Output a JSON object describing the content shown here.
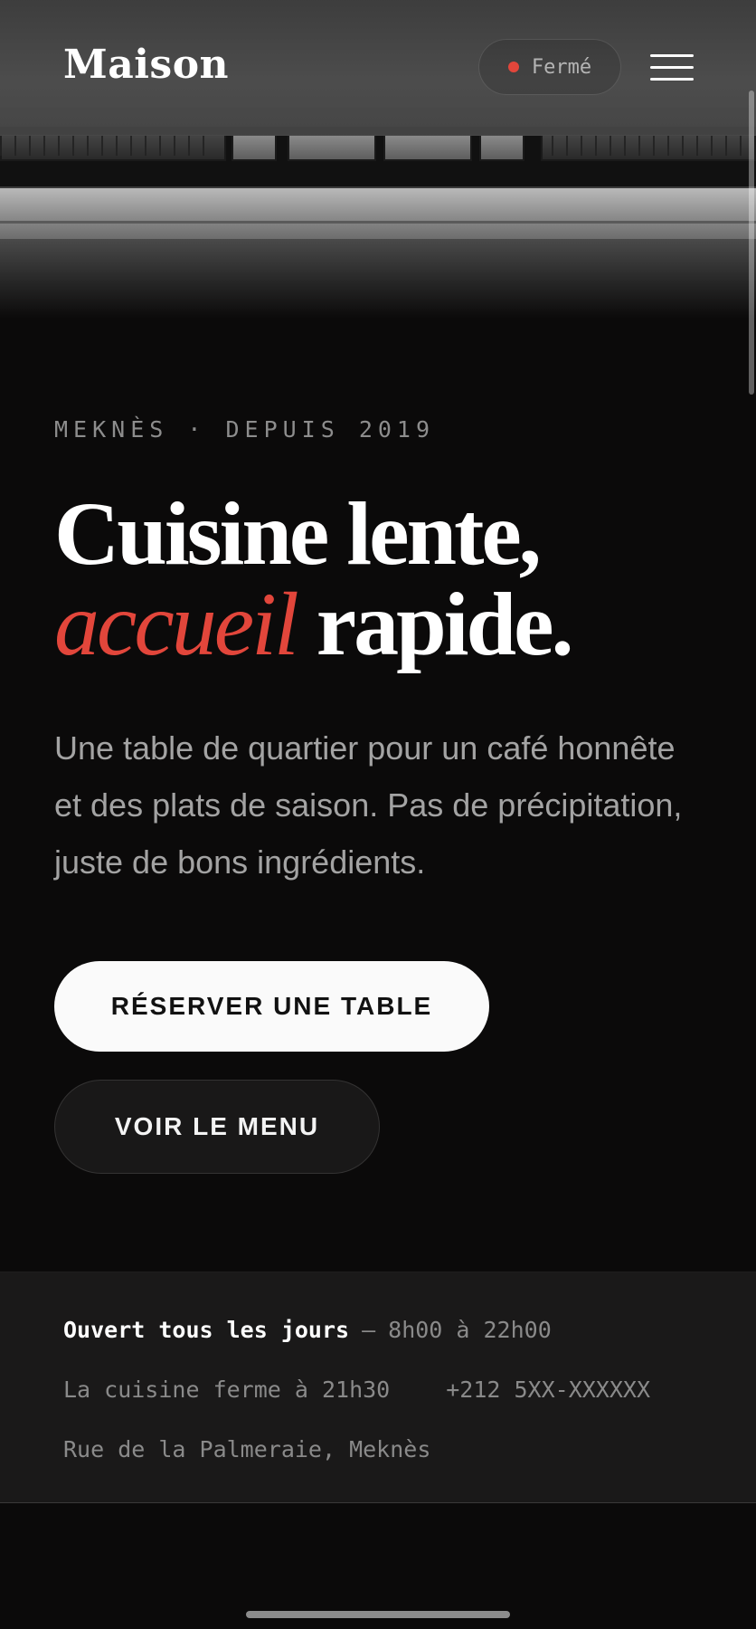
{
  "header": {
    "logo": "Maison",
    "status_label": "Fermé",
    "status_color": "#e2463b",
    "menu_icon": "hamburger-menu-icon"
  },
  "hero": {
    "eyebrow": "MEKNÈS · DEPUIS 2019",
    "headline_line1": "Cuisine lente,",
    "headline_accent": "accueil",
    "headline_line2_rest": "rapide.",
    "accent_color": "#e2463b",
    "intro": "Une table de quartier pour un café honnête et des plats de saison. Pas de précipitation, juste de bons ingrédients.",
    "primary_button": "RÉSERVER UNE TABLE",
    "secondary_button": "VOIR LE MENU"
  },
  "info": {
    "hours_label": "Ouvert tous les jours",
    "hours_separator": "—",
    "hours_value": "8h00 à 22h00",
    "kitchen_note": "La cuisine ferme à 21h30",
    "phone": "+212 5XX-XXXXXX",
    "address": "Rue de la Palmeraie, Meknès"
  }
}
